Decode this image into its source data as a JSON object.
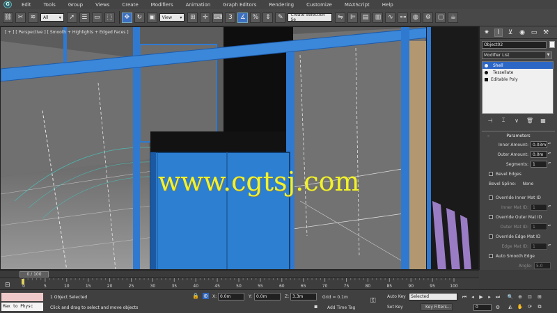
{
  "menu": {
    "logo_letter": "G",
    "items": [
      "Edit",
      "Tools",
      "Group",
      "Views",
      "Create",
      "Modifiers",
      "Animation",
      "Graph Editors",
      "Rendering",
      "Customize",
      "MAXScript",
      "Help"
    ]
  },
  "toolbar": {
    "selection_filter": "All",
    "reference_coord": "View",
    "snap_label": "3",
    "named_selection": "Create Selection Se"
  },
  "viewport": {
    "label": "[ + ] [ Perspective ] [ Smooth + Highlights + Edged Faces ]",
    "watermark": "www.cgtsj.com",
    "note": "label text approximate; original is blurred"
  },
  "command_panel": {
    "object_name": "Object02",
    "modifier_list_label": "Modifier List",
    "stack": [
      {
        "label": "Shell",
        "selected": true,
        "kind": "modifier"
      },
      {
        "label": "Tessellate",
        "selected": false,
        "kind": "modifier"
      },
      {
        "label": "Editable Poly",
        "selected": false,
        "kind": "base"
      }
    ],
    "rollout_title": "Parameters",
    "inner_amount_label": "Inner Amount:",
    "inner_amount_value": "0.03m",
    "outer_amount_label": "Outer Amount:",
    "outer_amount_value": "0.0m",
    "segments_label": "Segments:",
    "segments_value": "1",
    "bevel_edges_label": "Bevel Edges",
    "bevel_spline_label": "Bevel Spline:",
    "bevel_spline_value": "None",
    "override_inner_label": "Override Inner Mat ID",
    "inner_mat_label": "Inner Mat ID:",
    "inner_mat_value": "1",
    "override_outer_label": "Override Outer Mat ID",
    "outer_mat_label": "Outer Mat ID:",
    "outer_mat_value": "1",
    "override_edge_label": "Override Edge Mat ID",
    "edge_mat_label": "Edge Mat ID:",
    "edge_mat_value": "1",
    "auto_smooth_label": "Auto Smooth Edge",
    "angle_label": "Angle:",
    "angle_value": "5.0"
  },
  "timeline": {
    "time_display": "0 / 100",
    "ticks": [
      "0",
      "5",
      "10",
      "15",
      "20",
      "25",
      "30",
      "35",
      "40",
      "45",
      "50",
      "55",
      "60",
      "65",
      "70",
      "75",
      "80",
      "85",
      "90",
      "95",
      "100"
    ]
  },
  "status": {
    "script_text": "Max to Physc",
    "status_text": "1 Object Selected",
    "prompt_text": "Click and drag to select and move objects",
    "x_label": "X:",
    "x_value": "0.0m",
    "y_label": "Y:",
    "y_value": "0.0m",
    "z_label": "Z:",
    "z_value": "3.3m",
    "grid_text": "Grid = 0.1m",
    "add_time_tag": "Add Time Tag",
    "auto_key": "Auto Key",
    "selected_dropdown": "Selected",
    "set_key": "Set Key",
    "key_filters": "Key Filters...",
    "current_frame": "0"
  },
  "colors": {
    "selection_blue": "#2f7ad0",
    "watermark_yellow": "#f2f22a",
    "highlight_blue": "#2d67c6"
  }
}
